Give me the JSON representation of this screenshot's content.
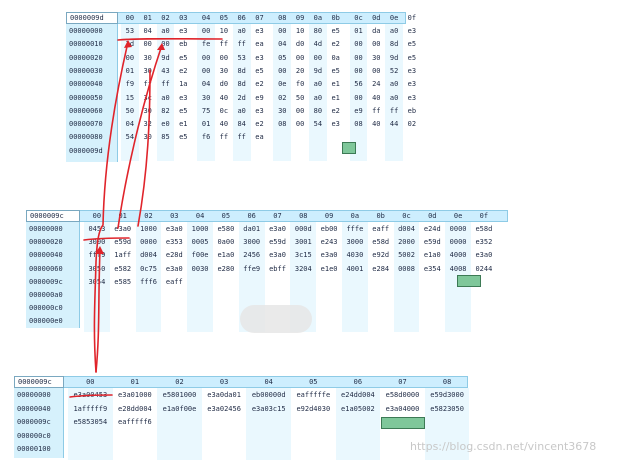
{
  "panel_top": {
    "corner": "0000009d",
    "headers": [
      "00",
      "01",
      "02",
      "03",
      "04",
      "05",
      "06",
      "07",
      "08",
      "09",
      "0a",
      "0b",
      "0c",
      "0d",
      "0e",
      "0f"
    ],
    "addresses": [
      "00000000",
      "00000010",
      "00000020",
      "00000030",
      "00000040",
      "00000050",
      "00000060",
      "00000070",
      "00000080",
      "0000009d"
    ],
    "rows": [
      [
        "53",
        "04",
        "a0",
        "e3",
        "00",
        "10",
        "a0",
        "e3",
        "00",
        "10",
        "80",
        "e5",
        "01",
        "da",
        "a0",
        "e3"
      ],
      [
        "2d",
        "00",
        "00",
        "eb",
        "fe",
        "ff",
        "ff",
        "ea",
        "04",
        "d0",
        "4d",
        "e2",
        "00",
        "00",
        "8d",
        "e5"
      ],
      [
        "00",
        "30",
        "9d",
        "e5",
        "00",
        "00",
        "53",
        "e3",
        "05",
        "00",
        "00",
        "0a",
        "00",
        "30",
        "9d",
        "e5"
      ],
      [
        "01",
        "30",
        "43",
        "e2",
        "00",
        "30",
        "8d",
        "e5",
        "00",
        "20",
        "9d",
        "e5",
        "00",
        "00",
        "52",
        "e3"
      ],
      [
        "f9",
        "ff",
        "ff",
        "1a",
        "04",
        "d0",
        "8d",
        "e2",
        "0e",
        "f0",
        "a0",
        "e1",
        "56",
        "24",
        "a0",
        "e3"
      ],
      [
        "15",
        "3c",
        "a0",
        "e3",
        "30",
        "40",
        "2d",
        "e9",
        "02",
        "50",
        "a0",
        "e1",
        "00",
        "40",
        "a0",
        "e3"
      ],
      [
        "50",
        "30",
        "82",
        "e5",
        "75",
        "0c",
        "a0",
        "e3",
        "30",
        "00",
        "80",
        "e2",
        "e9",
        "ff",
        "ff",
        "eb"
      ],
      [
        "04",
        "32",
        "e0",
        "e1",
        "01",
        "40",
        "84",
        "e2",
        "08",
        "00",
        "54",
        "e3",
        "08",
        "40",
        "44",
        "02"
      ],
      [
        "54",
        "30",
        "85",
        "e5",
        "f6",
        "ff",
        "ff",
        "ea",
        "",
        "",
        "",
        "",
        "",
        "",
        "",
        ""
      ],
      [
        "",
        "",
        "",
        "",
        "",
        "",
        "",
        "",
        "",
        "",
        "",
        "",
        "",
        "",
        "",
        ""
      ]
    ]
  },
  "panel_mid": {
    "corner": "0000009c",
    "headers": [
      "00",
      "01",
      "02",
      "03",
      "04",
      "05",
      "06",
      "07",
      "08",
      "09",
      "0a",
      "0b",
      "0c",
      "0d",
      "0e",
      "0f"
    ],
    "addresses": [
      "00000000",
      "00000020",
      "00000040",
      "00000060",
      "0000009c",
      "000000a0",
      "000000c0",
      "000000e0"
    ],
    "rows": [
      [
        "0453",
        "e3a0",
        "1000",
        "e3a0",
        "1000",
        "e580",
        "da01",
        "e3a0",
        "000d",
        "eb00",
        "fffe",
        "eaff",
        "d004",
        "e24d",
        "0000",
        "e58d"
      ],
      [
        "3000",
        "e59d",
        "0000",
        "e353",
        "0005",
        "0a00",
        "3000",
        "e59d",
        "3001",
        "e243",
        "3000",
        "e58d",
        "2000",
        "e59d",
        "0000",
        "e352"
      ],
      [
        "fff9",
        "1aff",
        "d004",
        "e28d",
        "f00e",
        "e1a0",
        "2456",
        "e3a0",
        "3c15",
        "e3a0",
        "4030",
        "e92d",
        "5002",
        "e1a0",
        "4000",
        "e3a0"
      ],
      [
        "3050",
        "e582",
        "0c75",
        "e3a0",
        "0030",
        "e280",
        "ffe9",
        "ebff",
        "3204",
        "e1e0",
        "4001",
        "e284",
        "0008",
        "e354",
        "4008",
        "0244"
      ],
      [
        "3054",
        "e585",
        "fff6",
        "eaff",
        "",
        "",
        "",
        "",
        "",
        "",
        "",
        "",
        "",
        "",
        "",
        ""
      ],
      [
        "",
        "",
        "",
        "",
        "",
        "",
        "",
        "",
        "",
        "",
        "",
        "",
        "",
        "",
        "",
        ""
      ],
      [
        "",
        "",
        "",
        "",
        "",
        "",
        "",
        "",
        "",
        "",
        "",
        "",
        "",
        "",
        "",
        ""
      ],
      [
        "",
        "",
        "",
        "",
        "",
        "",
        "",
        "",
        "",
        "",
        "",
        "",
        "",
        "",
        "",
        ""
      ]
    ]
  },
  "panel_bot": {
    "corner": "0000009c",
    "headers": [
      "00",
      "01",
      "02",
      "03",
      "04",
      "05",
      "06",
      "07",
      "08"
    ],
    "addresses": [
      "00000000",
      "00000040",
      "0000009c",
      "000000c0",
      "00000100"
    ],
    "rows": [
      [
        "e3a00453",
        "e3a01000",
        "e5801000",
        "e3a0da01",
        "eb00000d",
        "eafffffe",
        "e24dd004",
        "e58d0000",
        "e59d3000"
      ],
      [
        "1afffff9",
        "e28dd004",
        "e1a0f00e",
        "e3a02456",
        "e3a03c15",
        "e92d4030",
        "e1a05002",
        "e3a04000",
        "e5823050"
      ],
      [
        "e5853054",
        "eafffff6",
        "",
        "",
        "",
        "",
        "",
        "",
        ""
      ],
      [
        "",
        "",
        "",
        "",
        "",
        "",
        "",
        "",
        ""
      ],
      [
        "",
        "",
        "",
        "",
        "",
        "",
        "",
        "",
        ""
      ]
    ]
  },
  "watermark": "https://blog.csdn.net/vincent3678",
  "colors": {
    "header_bg": "#cdeefe",
    "cursor": "#7fc79a",
    "annotation": "#e0242b"
  }
}
